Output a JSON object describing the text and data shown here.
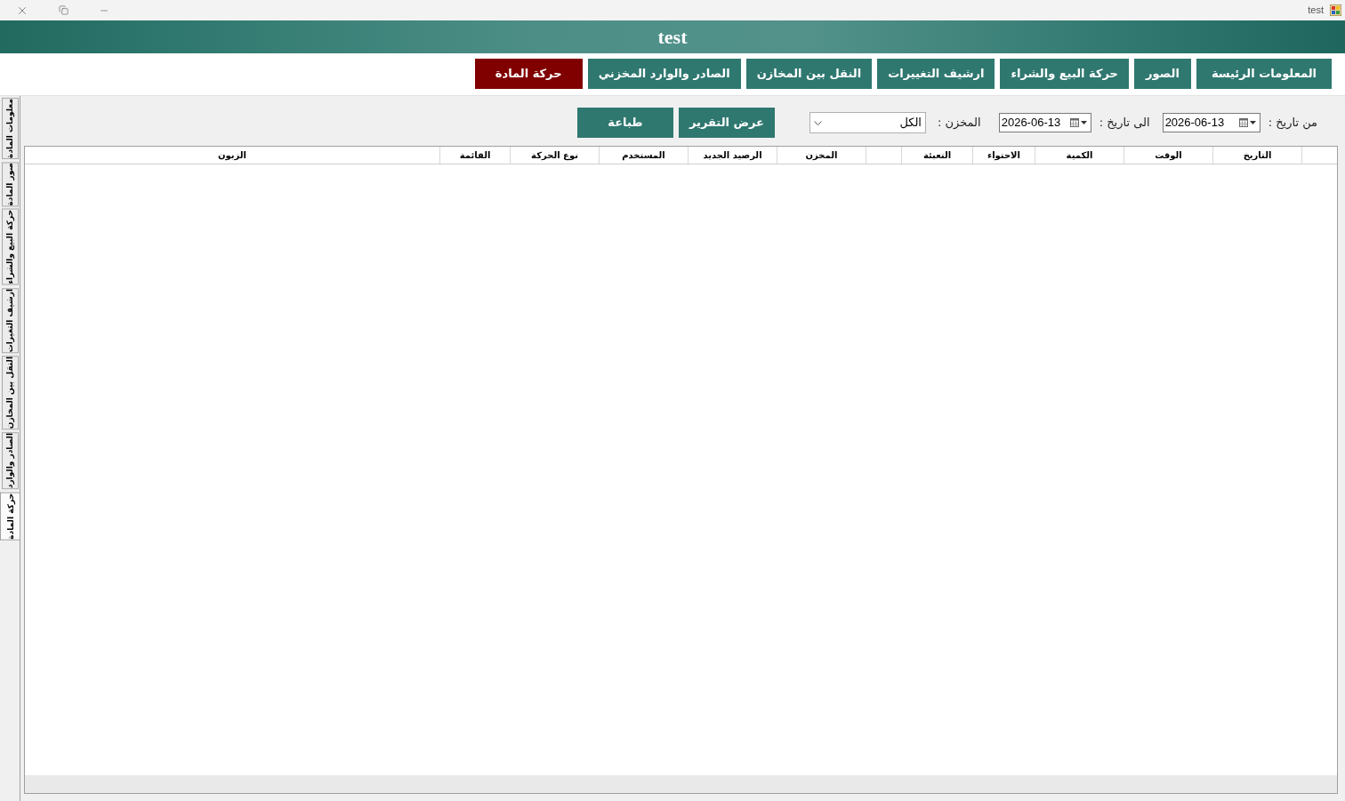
{
  "window": {
    "title": "test"
  },
  "header": {
    "title": "test"
  },
  "nav_tabs": [
    {
      "label": "المعلومات الرئيسة",
      "selected": false
    },
    {
      "label": "الصور",
      "selected": false
    },
    {
      "label": "حركة البيع والشراء",
      "selected": false
    },
    {
      "label": "ارشيف التغييرات",
      "selected": false
    },
    {
      "label": "النقل بين المخازن",
      "selected": false
    },
    {
      "label": "الصادر والوارد المخزني",
      "selected": false
    },
    {
      "label": "حركة المادة",
      "selected": true
    }
  ],
  "side_tabs": [
    {
      "label": "معلومات المادة",
      "selected": false
    },
    {
      "label": "صور المادة",
      "selected": false
    },
    {
      "label": "حركة البيع والشراء",
      "selected": false
    },
    {
      "label": "ارشيف التغيرات",
      "selected": false
    },
    {
      "label": "النقل بين المخازن",
      "selected": false
    },
    {
      "label": "الصادر والوارد",
      "selected": false
    },
    {
      "label": "حركة المادة",
      "selected": true
    }
  ],
  "filters": {
    "from_label": "من تاريخ :",
    "from_date": "2026-06-13",
    "to_label": "الى تاريخ :",
    "to_date": "2026-06-13",
    "warehouse_label": "المخزن :",
    "warehouse_value": "الكل"
  },
  "actions": [
    "عرض التقرير",
    "طباعة"
  ],
  "table": {
    "columns": [
      "التاريخ",
      "الوقت",
      "الكمية",
      "الاحتواء",
      "التعبئة",
      "المخزن",
      "الرصيد الجديد",
      "المستخدم",
      "نوع الحركة",
      "القائمة",
      "الزبون"
    ]
  }
}
